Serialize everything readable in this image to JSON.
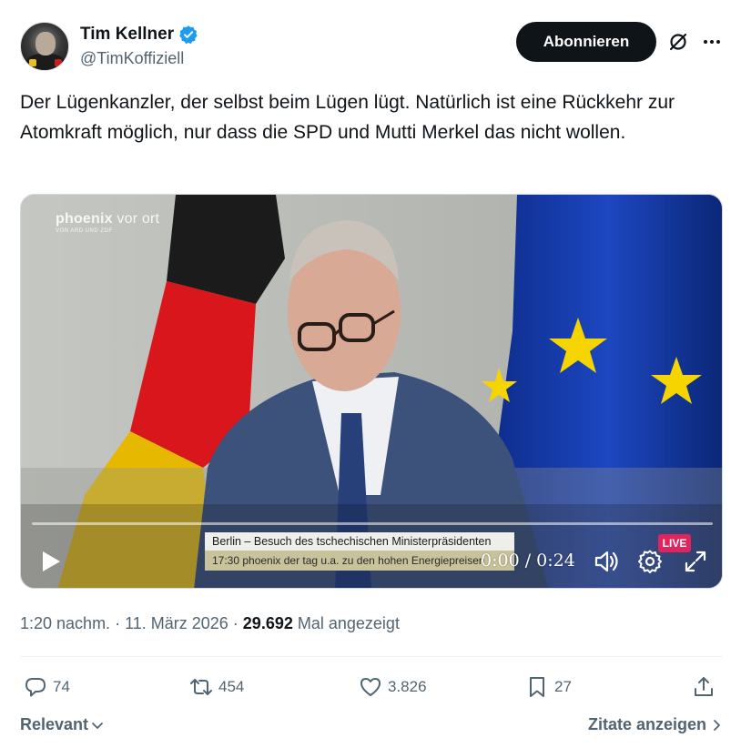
{
  "author": {
    "display_name": "Tim Kellner",
    "handle": "@TimKoffiziell",
    "verified": true,
    "verified_color": "#1d9bf0"
  },
  "header": {
    "subscribe_label": "Abonnieren",
    "grok_icon": "grok-slash-circle-icon",
    "more_icon": "more-horizontal-icon"
  },
  "tweet": {
    "text": "Der Lügenkanzler, der selbst beim Lügen lügt. Natürlich ist eine Rückkehr zur Atomkraft möglich, nur dass die SPD und Mutti Merkel das nicht wollen."
  },
  "video": {
    "channel_logo_main": "phoenix",
    "channel_logo_suffix": "vor ort",
    "channel_logo_sub": "VON ARD UND ZDF",
    "lower_third_line1": "Berlin – Besuch des tschechischen Ministerpräsidenten",
    "lower_third_line2": "17:30   phoenix der tag u.a. zu den hohen Energiepreisen",
    "live_label": "LIVE",
    "time": "0:00 / 0:24",
    "progress": 0.0
  },
  "meta": {
    "time": "1:20 nachm.",
    "separator": " · ",
    "date": "11. März 2026",
    "views": "29.692",
    "views_label": "Mal angezeigt"
  },
  "actions": {
    "replies": "74",
    "reposts": "454",
    "likes": "3.826",
    "bookmarks": "27"
  },
  "footer": {
    "sort_label": "Relevant",
    "quotes_label": "Zitate anzeigen"
  },
  "colors": {
    "text_primary": "#0f1419",
    "text_secondary": "#536471",
    "live_red": "#e0245e"
  }
}
